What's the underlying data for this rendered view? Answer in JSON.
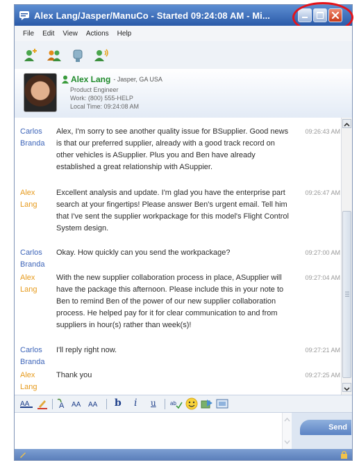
{
  "window": {
    "title": "Alex Lang/Jasper/ManuCo - Started 09:24:08 AM - Mi..."
  },
  "menu": [
    "File",
    "Edit",
    "View",
    "Actions",
    "Help"
  ],
  "toolbar_icons": [
    "add-contact-icon",
    "group-icon",
    "pin-icon",
    "voice-call-icon"
  ],
  "contact": {
    "name": "Alex Lang",
    "location": "- Jasper, GA USA",
    "title": "Product Engineer",
    "phone": "Work: (800) 555-HELP",
    "local_time": "Local Time: 09:24:08 AM"
  },
  "messages": [
    {
      "sender": "Carlos Branda",
      "text": "Alex, I'm sorry to see another quality issue for BSupplier.  Good news is that our preferred supplier, already with a good track record on other vehicles is ASupplier.  Plus you and Ben have already established a great relationship with ASuppier.",
      "time": "09:26:43 AM"
    },
    {
      "sender": "Alex Lang",
      "text": "Excellent analysis and update.  I'm glad you have the enterprise part search at your fingertips!  Please answer Ben's urgent email.  Tell him that I've sent the supplier workpackage for this model's Flight Control System design.",
      "time": "09:26:47 AM"
    },
    {
      "sender": "Carlos Branda",
      "text": "Okay. How quickly can you send the workpackage?",
      "time": "09:27:00 AM"
    },
    {
      "sender": "Alex Lang",
      "text": "With the new supplier collaboration process in place, ASupplier will have the package this afternoon.  Please include this in your note to Ben to remind Ben of the power of our new supplier collaboration process. He helped pay for it for clear communication to and from suppliers in hour(s) rather than week(s)!",
      "time": "09:27:04 AM"
    },
    {
      "sender": "Carlos Branda",
      "text": "I'll reply right now.",
      "time": "09:27:21 AM"
    },
    {
      "sender": "Alex Lang",
      "text": "Thank you",
      "time": "09:27:25 AM"
    }
  ],
  "format_toolbar": {
    "bold": "b",
    "italic": "i",
    "underline": "u"
  },
  "send_label": "Send",
  "colors": {
    "titlebar": "#2a5aa8",
    "carlos": "#3e65b9",
    "alex": "#e69a1c",
    "contact_name": "#1f8a2a",
    "highlight": "#e5131a"
  }
}
